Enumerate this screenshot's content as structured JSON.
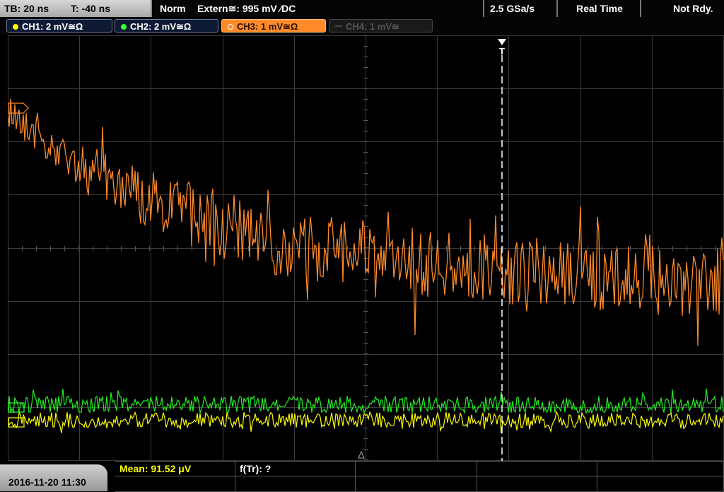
{
  "topbar": {
    "timebase": "TB: 20 ns",
    "trigger_time": "T: -40 ns",
    "trigger_mode": "Norm",
    "trigger_source": "Extern≅: 995 mV ∕DC",
    "sample_rate": "2.5 GSa/s",
    "acq_mode": "Real Time",
    "status": "Not Rdy."
  },
  "channels": [
    {
      "label": "CH1: 2 mV≅Ω",
      "color": "#ffff00",
      "active": true
    },
    {
      "label": "CH2: 2 mV≅Ω",
      "color": "#33ff33",
      "active": true
    },
    {
      "label": "CH3: 1 mV≅Ω",
      "color": "#ff8a2a",
      "active": true,
      "selected": true
    },
    {
      "label": "CH4: 1 mV≅",
      "color": "#555555",
      "active": false
    }
  ],
  "trigger_marker": "T",
  "date": "2016-11-20 11:30",
  "measurements": {
    "mean": "Mean: 91.52 μV",
    "freq": "f(Tr): ?"
  },
  "colors": {
    "ch1": "#ffff00",
    "ch2": "#22ee22",
    "ch3": "#ff8a2a",
    "grid": "#3a3a3a",
    "trigger": "#ffffff"
  }
}
